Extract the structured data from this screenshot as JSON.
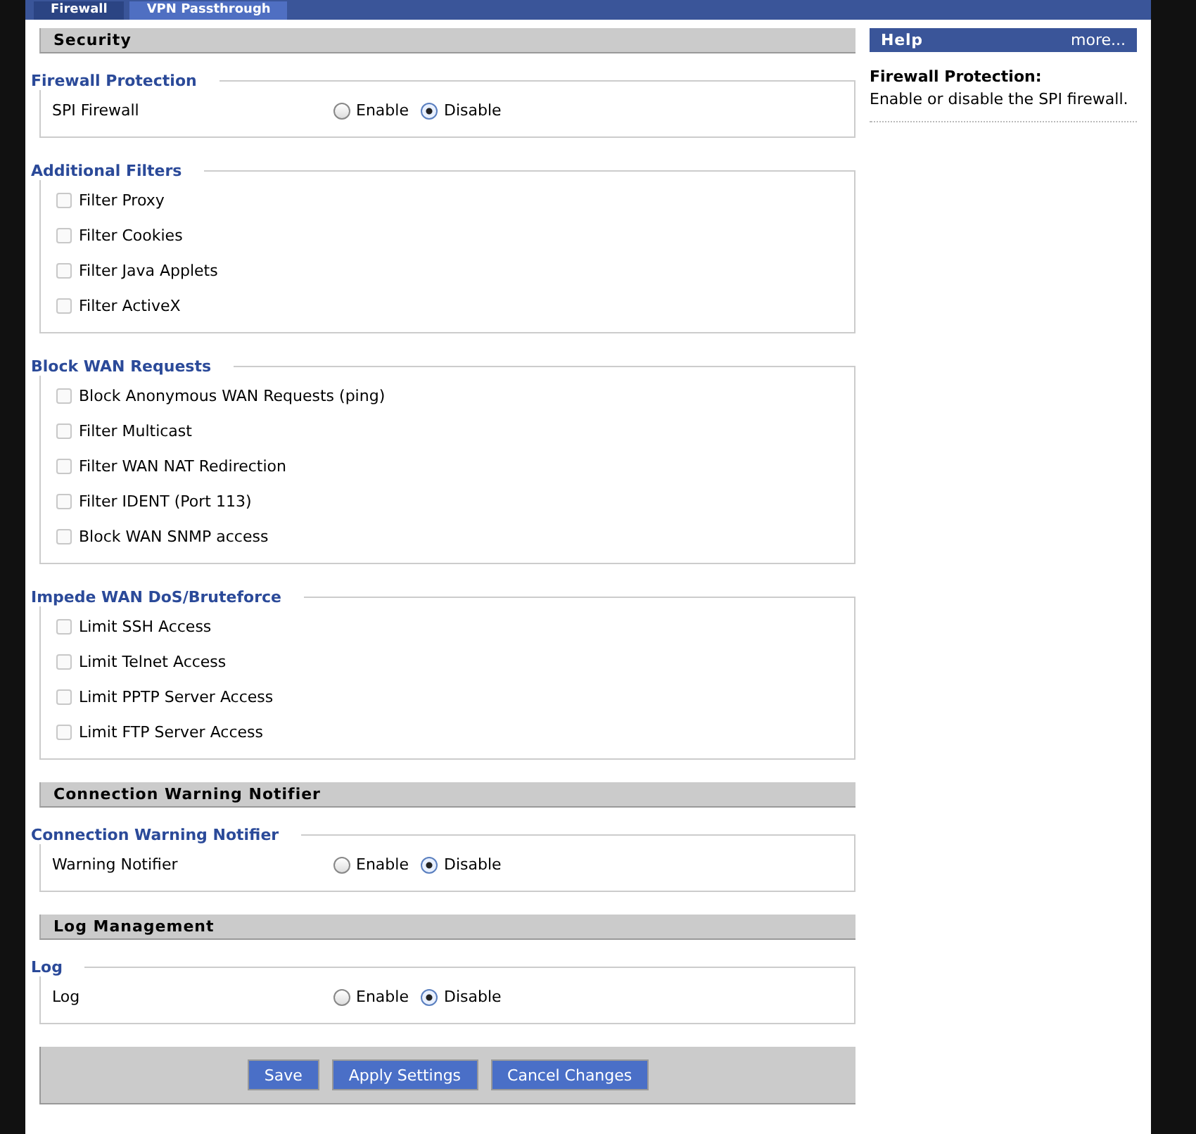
{
  "tabs": [
    {
      "label": "Firewall",
      "selected": false
    },
    {
      "label": "VPN Passthrough",
      "selected": true
    }
  ],
  "sections": [
    {
      "title": "Security",
      "groups": [
        {
          "legend": "Firewall Protection",
          "rows": [
            {
              "kind": "radio",
              "label": "SPI Firewall",
              "options": [
                {
                  "label": "Enable",
                  "selected": false
                },
                {
                  "label": "Disable",
                  "selected": true
                }
              ]
            }
          ]
        },
        {
          "legend": "Additional Filters",
          "rows": [
            {
              "kind": "checkbox",
              "label": "Filter Proxy",
              "checked": false
            },
            {
              "kind": "checkbox",
              "label": "Filter Cookies",
              "checked": false
            },
            {
              "kind": "checkbox",
              "label": "Filter Java Applets",
              "checked": false
            },
            {
              "kind": "checkbox",
              "label": "Filter ActiveX",
              "checked": false
            }
          ]
        },
        {
          "legend": "Block WAN Requests",
          "rows": [
            {
              "kind": "checkbox",
              "label": "Block Anonymous WAN Requests (ping)",
              "checked": false
            },
            {
              "kind": "checkbox",
              "label": "Filter Multicast",
              "checked": false
            },
            {
              "kind": "checkbox",
              "label": "Filter WAN NAT Redirection",
              "checked": false
            },
            {
              "kind": "checkbox",
              "label": "Filter IDENT (Port 113)",
              "checked": false
            },
            {
              "kind": "checkbox",
              "label": "Block WAN SNMP access",
              "checked": false
            }
          ]
        },
        {
          "legend": "Impede WAN DoS/Bruteforce",
          "rows": [
            {
              "kind": "checkbox",
              "label": "Limit SSH Access",
              "checked": false
            },
            {
              "kind": "checkbox",
              "label": "Limit Telnet Access",
              "checked": false
            },
            {
              "kind": "checkbox",
              "label": "Limit PPTP Server Access",
              "checked": false
            },
            {
              "kind": "checkbox",
              "label": "Limit FTP Server Access",
              "checked": false
            }
          ]
        }
      ]
    },
    {
      "title": "Connection Warning Notifier",
      "groups": [
        {
          "legend": "Connection Warning Notifier",
          "rows": [
            {
              "kind": "radio",
              "label": "Warning Notifier",
              "options": [
                {
                  "label": "Enable",
                  "selected": false
                },
                {
                  "label": "Disable",
                  "selected": true
                }
              ]
            }
          ]
        }
      ]
    },
    {
      "title": "Log Management",
      "groups": [
        {
          "legend": "Log",
          "rows": [
            {
              "kind": "radio",
              "label": "Log",
              "options": [
                {
                  "label": "Enable",
                  "selected": false
                },
                {
                  "label": "Disable",
                  "selected": true
                }
              ]
            }
          ]
        }
      ]
    }
  ],
  "buttons": [
    "Save",
    "Apply Settings",
    "Cancel Changes"
  ],
  "help": {
    "title": "Help",
    "more": "more...",
    "topic": "Firewall Protection:",
    "text": "Enable or disable the SPI firewall."
  }
}
